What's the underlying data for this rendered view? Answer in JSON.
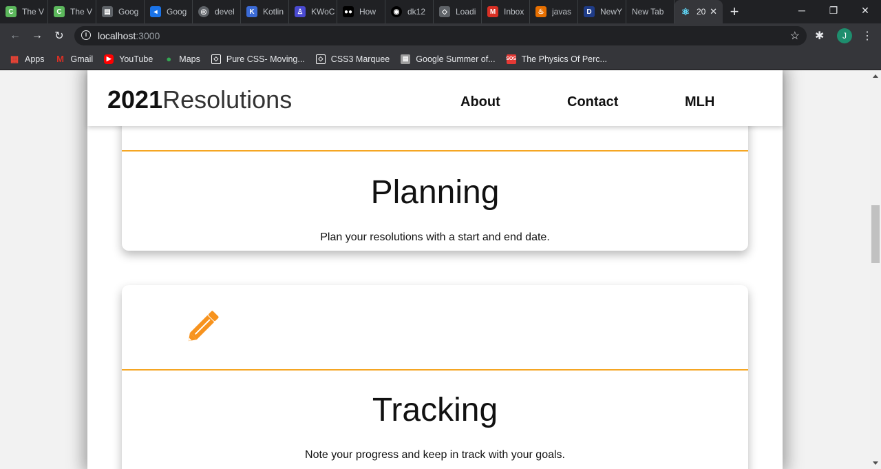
{
  "browser": {
    "tabs": [
      {
        "label": "The V",
        "icon": "codechef-icon",
        "color": "#5cb85c"
      },
      {
        "label": "The V",
        "icon": "codechef-icon",
        "color": "#5cb85c"
      },
      {
        "label": "Goog",
        "icon": "google-docs-icon",
        "color": "#5f6368"
      },
      {
        "label": "Goog",
        "icon": "google-meet-icon",
        "color": "#1a73e8"
      },
      {
        "label": "devel",
        "icon": "globe-icon",
        "color": "#5f6368"
      },
      {
        "label": "Kotlin",
        "icon": "kotlin-icon",
        "color": "#3b6bd6"
      },
      {
        "label": "KWoC",
        "icon": "kwoc-icon",
        "color": "#4a4ad1"
      },
      {
        "label": "How",
        "icon": "medium-icon",
        "color": "#000000"
      },
      {
        "label": "dk12",
        "icon": "github-icon",
        "color": "#000000"
      },
      {
        "label": "Loadi",
        "icon": "codesandbox-icon",
        "color": "#5f6368"
      },
      {
        "label": "Inbox",
        "icon": "gmail-icon",
        "color": "#d93025"
      },
      {
        "label": "javas",
        "icon": "java-icon",
        "color": "#e76f00"
      },
      {
        "label": "NewY",
        "icon": "dev-icon",
        "color": "#1f3c88"
      },
      {
        "label": "New Tab",
        "icon": "",
        "color": ""
      },
      {
        "label": "20",
        "icon": "react-icon",
        "color": "#61dafb"
      }
    ],
    "url_host": "localhost",
    "url_port": ":3000",
    "profile_initial": "J",
    "bookmarks": [
      {
        "label": "Apps",
        "icon": "apps-grid-icon",
        "color": "#ea4335"
      },
      {
        "label": "Gmail",
        "icon": "gmail-icon",
        "color": "#d93025"
      },
      {
        "label": "YouTube",
        "icon": "youtube-icon",
        "color": "#ff0000"
      },
      {
        "label": "Maps",
        "icon": "maps-pin-icon",
        "color": "#34a853"
      },
      {
        "label": "Pure CSS- Moving...",
        "icon": "codepen-icon",
        "color": "#ffffff"
      },
      {
        "label": "CSS3 Marquee",
        "icon": "codepen-icon",
        "color": "#ffffff"
      },
      {
        "label": "Google Summer of...",
        "icon": "gsoc-icon",
        "color": "#9e9e9e"
      },
      {
        "label": "The Physics Of Perc...",
        "icon": "sos-icon",
        "color": "#e53935"
      }
    ]
  },
  "site": {
    "logo_number": "2021",
    "logo_word": "Resolutions",
    "nav": [
      "About",
      "Contact",
      "MLH"
    ],
    "accent": "#f5a623"
  },
  "cards": [
    {
      "title": "Planning",
      "description": "Plan your resolutions with a start and end date."
    },
    {
      "title": "Tracking",
      "description": "Note your progress and keep in track with your goals.",
      "icon": "pencil-icon"
    }
  ]
}
